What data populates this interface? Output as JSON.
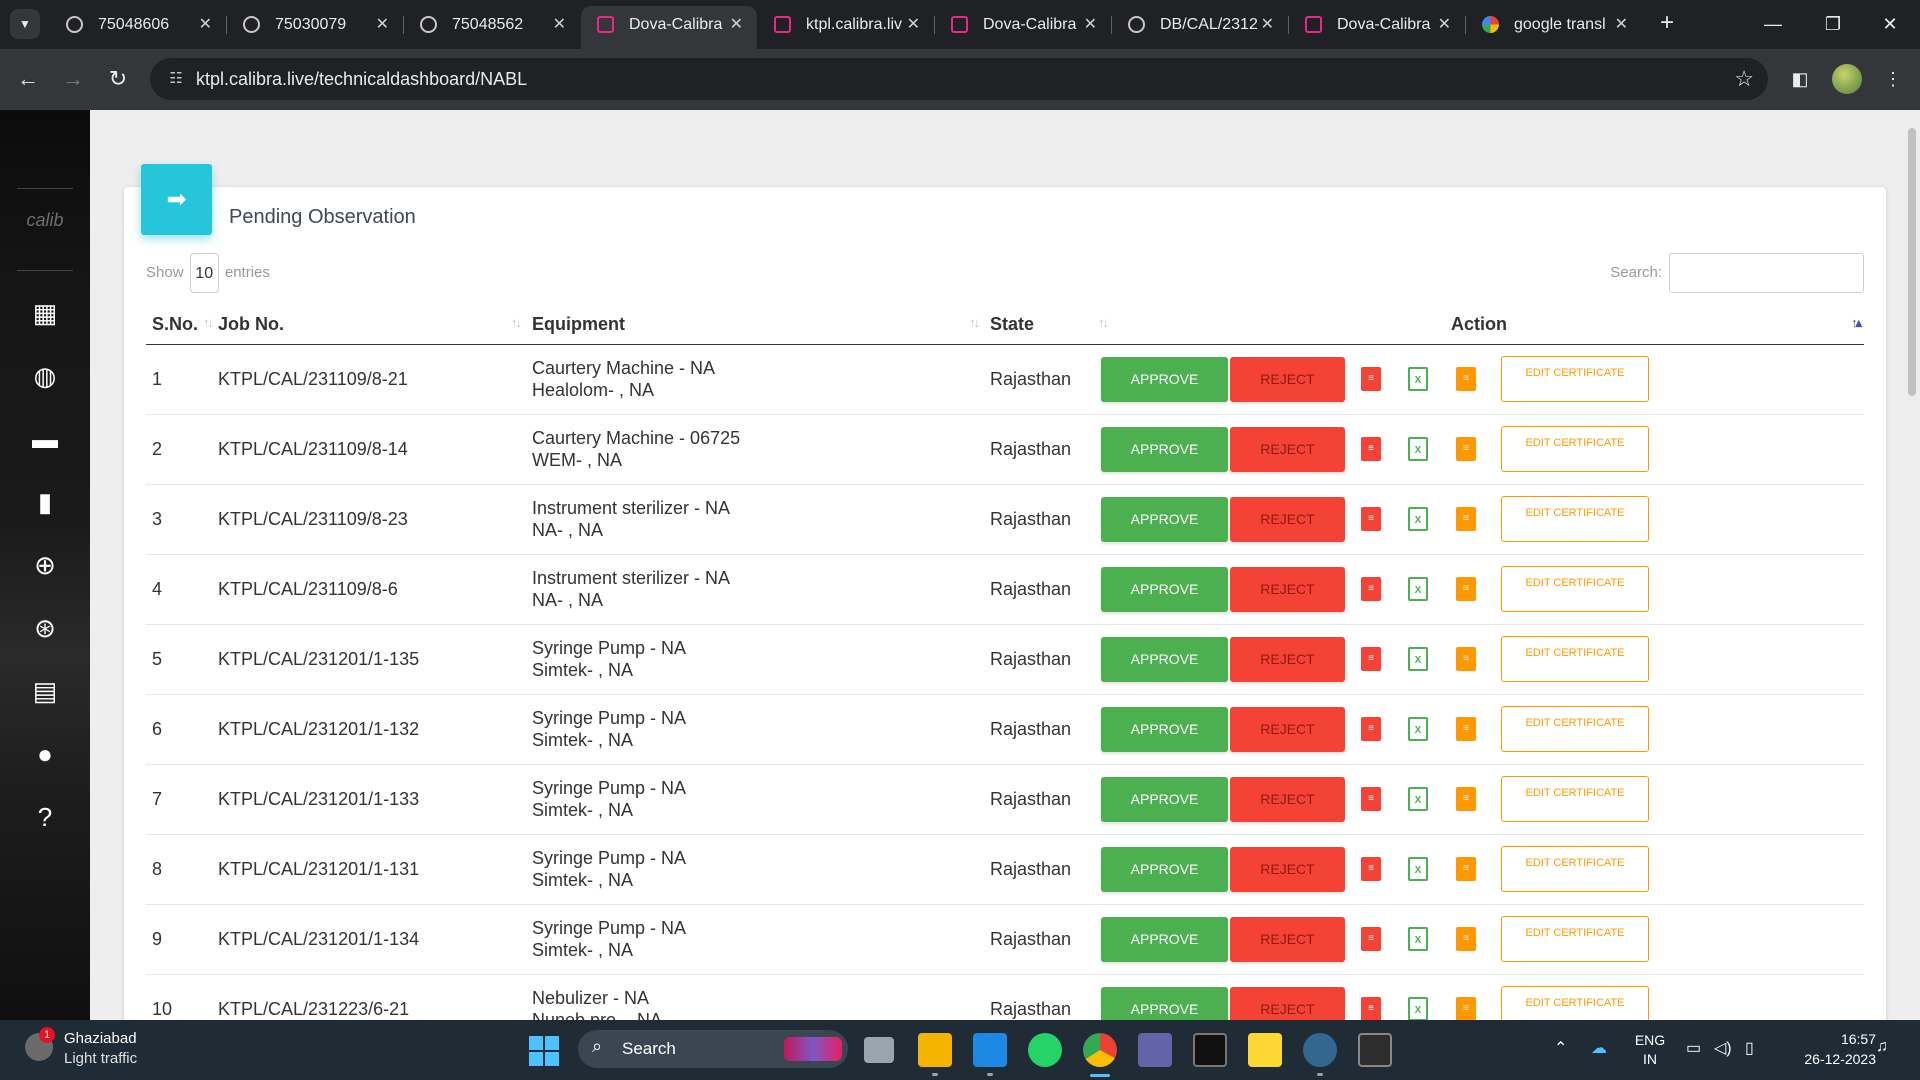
{
  "browser": {
    "tabs": [
      {
        "title": "75048606",
        "icon": "globe-icon"
      },
      {
        "title": "75030079",
        "icon": "globe-icon"
      },
      {
        "title": "75048562",
        "icon": "globe-icon"
      },
      {
        "title": "Dova-Calibra",
        "icon": "calibra-icon",
        "active": true
      },
      {
        "title": "ktpl.calibra.liv",
        "icon": "calibra-icon"
      },
      {
        "title": "Dova-Calibra",
        "icon": "calibra-icon"
      },
      {
        "title": "DB/CAL/2312",
        "icon": "globe-icon"
      },
      {
        "title": "Dova-Calibra",
        "icon": "calibra-icon"
      },
      {
        "title": "google transl",
        "icon": "google-icon"
      }
    ],
    "url": "ktpl.calibra.live/technicaldashboard/NABL"
  },
  "sidebar": {
    "brand": "calib",
    "items": [
      "dashboard-icon",
      "palette-icon",
      "briefcase-icon",
      "book-icon",
      "zoom-in-icon",
      "query-stats-icon",
      "store-icon",
      "person-icon",
      "help-icon"
    ]
  },
  "page": {
    "card_title": "Pending Observation",
    "show_label": "Show",
    "entries_value": "10",
    "entries_label": "entries",
    "search_label": "Search:"
  },
  "table": {
    "headers": {
      "sn": "S.No.",
      "job": "Job No.",
      "equipment": "Equipment",
      "state": "State",
      "action": "Action"
    },
    "rows": [
      {
        "sn": "1",
        "job": "KTPL/CAL/231109/8-21",
        "eq1": "Caurtery Machine - NA",
        "eq2": "Healolom- , NA",
        "state": "Rajasthan"
      },
      {
        "sn": "2",
        "job": "KTPL/CAL/231109/8-14",
        "eq1": "Caurtery Machine - 06725",
        "eq2": "WEM- , NA",
        "state": "Rajasthan"
      },
      {
        "sn": "3",
        "job": "KTPL/CAL/231109/8-23",
        "eq1": "Instrument sterilizer - NA",
        "eq2": "NA- , NA",
        "state": "Rajasthan"
      },
      {
        "sn": "4",
        "job": "KTPL/CAL/231109/8-6",
        "eq1": "Instrument sterilizer - NA",
        "eq2": "NA- , NA",
        "state": "Rajasthan"
      },
      {
        "sn": "5",
        "job": "KTPL/CAL/231201/1-135",
        "eq1": "Syringe Pump - NA",
        "eq2": "Simtek- , NA",
        "state": "Rajasthan"
      },
      {
        "sn": "6",
        "job": "KTPL/CAL/231201/1-132",
        "eq1": "Syringe Pump - NA",
        "eq2": "Simtek- , NA",
        "state": "Rajasthan"
      },
      {
        "sn": "7",
        "job": "KTPL/CAL/231201/1-133",
        "eq1": "Syringe Pump - NA",
        "eq2": "Simtek- , NA",
        "state": "Rajasthan"
      },
      {
        "sn": "8",
        "job": "KTPL/CAL/231201/1-131",
        "eq1": "Syringe Pump - NA",
        "eq2": "Simtek- , NA",
        "state": "Rajasthan"
      },
      {
        "sn": "9",
        "job": "KTPL/CAL/231201/1-134",
        "eq1": "Syringe Pump - NA",
        "eq2": "Simtek- , NA",
        "state": "Rajasthan"
      },
      {
        "sn": "10",
        "job": "KTPL/CAL/231223/6-21",
        "eq1": "Nebulizer - NA",
        "eq2": "Nuneb pro- , NA",
        "state": "Rajasthan"
      }
    ],
    "approve_label": "APPROVE",
    "reject_label": "REJECT",
    "edit_label": "EDIT CERTIFICATE"
  },
  "taskbar": {
    "weather_badge": "1",
    "weather_city": "Ghaziabad",
    "weather_status": "Light traffic",
    "search_label": "Search",
    "lang_1": "ENG",
    "lang_2": "IN",
    "time": "16:57",
    "date": "26-12-2023"
  },
  "colors": {
    "approve": "#4caf50",
    "reject": "#f44336",
    "accent": "#26c6da",
    "edit": "#ff9800"
  }
}
